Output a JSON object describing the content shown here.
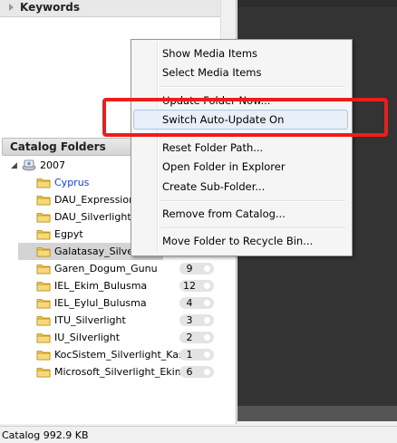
{
  "panels": {
    "keywords_title": "Keywords",
    "catalog_folders_title": "Catalog Folders"
  },
  "tree": {
    "root": "2007",
    "folders": [
      {
        "name": "Cyprus",
        "count": "",
        "link": true
      },
      {
        "name": "DAU_Expression_",
        "count": ""
      },
      {
        "name": "DAU_Silverlight_A",
        "count": ""
      },
      {
        "name": "Egpyt",
        "count": ""
      },
      {
        "name": "Galatasay_Silverlight",
        "count": "",
        "selected": true
      },
      {
        "name": "Garen_Dogum_Gunu",
        "count": "9"
      },
      {
        "name": "IEL_Ekim_Bulusma",
        "count": "12"
      },
      {
        "name": "IEL_Eylul_Bulusma",
        "count": "4"
      },
      {
        "name": "ITU_Silverlight",
        "count": "3"
      },
      {
        "name": "IU_Silverlight",
        "count": "2"
      },
      {
        "name": "KocSistem_Silverlight_Kasim",
        "count": "1"
      },
      {
        "name": "Microsoft_Silverlight_Ekim",
        "count": "6"
      }
    ]
  },
  "context_menu": {
    "items": [
      "Show Media Items",
      "Select Media Items",
      "Update Folder Now...",
      "Switch Auto-Update On",
      "Reset Folder Path...",
      "Open Folder in Explorer",
      "Create Sub-Folder...",
      "Remove from Catalog...",
      "Move Folder to Recycle Bin..."
    ]
  },
  "status": {
    "text": "Catalog  992.9 KB"
  },
  "colors": {
    "highlight": "#ee1c1c",
    "link": "#1a3fb8",
    "dark_pane": "#333333"
  }
}
